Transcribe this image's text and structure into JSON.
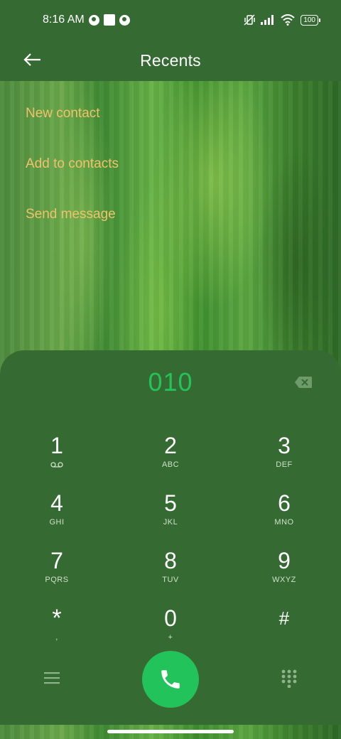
{
  "status_bar": {
    "time": "8:16 AM",
    "battery": "100",
    "icons": [
      "notification-circle-icon",
      "notification-square-icon",
      "notification-circle-icon",
      "mute-vibrate-icon",
      "signal-icon",
      "wifi-icon",
      "battery-icon"
    ]
  },
  "header": {
    "title": "Recents",
    "back_icon": "back-arrow-icon"
  },
  "menu": {
    "items": [
      {
        "label": "New contact"
      },
      {
        "label": "Add to contacts"
      },
      {
        "label": "Send message"
      }
    ]
  },
  "dialpad": {
    "number": "010",
    "keys": [
      {
        "digit": "1",
        "letters": "",
        "icon": "voicemail-icon"
      },
      {
        "digit": "2",
        "letters": "ABC"
      },
      {
        "digit": "3",
        "letters": "DEF"
      },
      {
        "digit": "4",
        "letters": "GHI"
      },
      {
        "digit": "5",
        "letters": "JKL"
      },
      {
        "digit": "6",
        "letters": "MNO"
      },
      {
        "digit": "7",
        "letters": "PQRS"
      },
      {
        "digit": "8",
        "letters": "TUV"
      },
      {
        "digit": "9",
        "letters": "WXYZ"
      },
      {
        "digit": "*",
        "letters": ","
      },
      {
        "digit": "0",
        "letters": "+"
      },
      {
        "digit": "#",
        "letters": ""
      }
    ]
  },
  "colors": {
    "background": "#356b32",
    "accent_link": "#f1c26a",
    "number_green": "#23c35a",
    "call_button": "#21c35a"
  }
}
